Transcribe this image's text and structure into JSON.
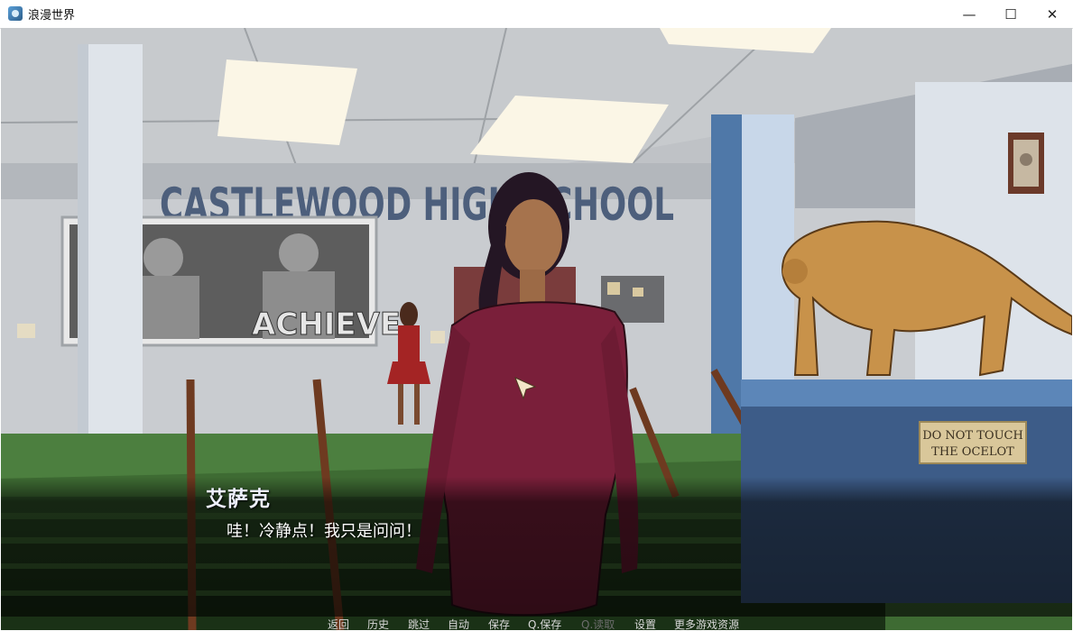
{
  "window": {
    "title": "浪漫世界",
    "icon": "game-app-icon",
    "controls": {
      "minimize": "—",
      "maximize": "☐",
      "close": "✕"
    }
  },
  "scene": {
    "banner_text": "CASTLEWOOD HIGH SCHOOL",
    "poster_text": "ACHIEVE",
    "plaque_line1": "DO NOT TOUCH",
    "plaque_line2": "THE OCELOT"
  },
  "dialogue": {
    "speaker": "艾萨克",
    "text": "哇！冷静点！我只是问问！"
  },
  "quick_menu": {
    "items": [
      "返回",
      "历史",
      "跳过",
      "自动",
      "保存",
      "Q.保存",
      "Q.读取",
      "设置",
      "更多游戏资源"
    ],
    "disabled_item": "Q.读取"
  },
  "colors": {
    "wall": "#c9ccd0",
    "banner_text": "#4d5f7c",
    "floor": "#3e6b33",
    "dress": "#7a1f3a",
    "ocelot": "#c8924a",
    "pedestal": "#3d5c88"
  }
}
